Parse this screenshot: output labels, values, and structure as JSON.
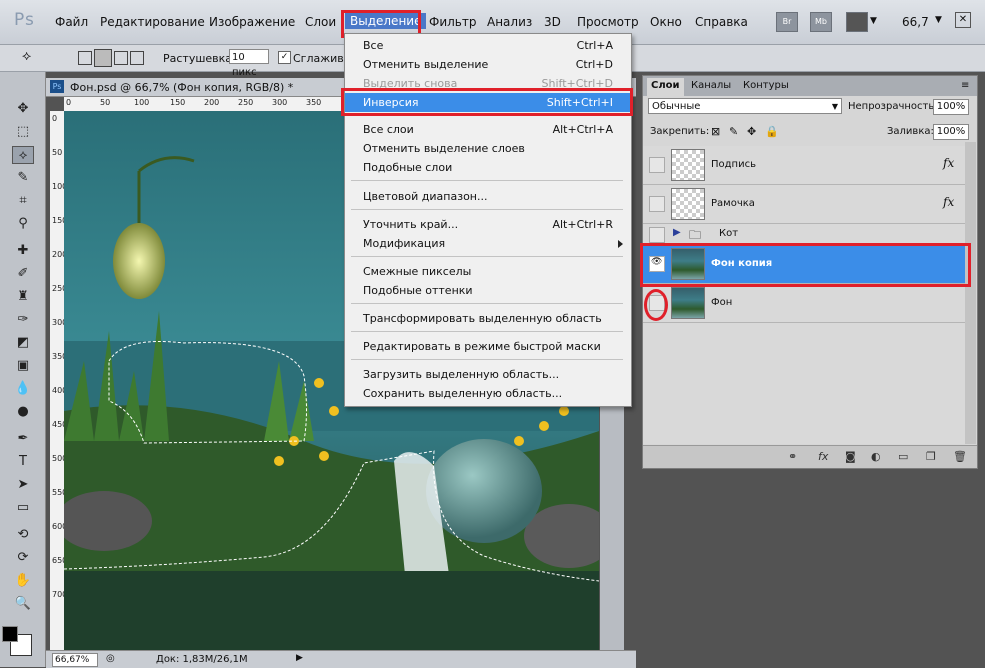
{
  "app": {
    "logo": "Ps"
  },
  "menubar": {
    "items": [
      "Файл",
      "Редактирование",
      "Изображение",
      "Слои",
      "Выделение",
      "Фильтр",
      "Анализ",
      "3D",
      "Просмотр",
      "Окно",
      "Справка"
    ],
    "buttons": [
      "Br",
      "Mb"
    ],
    "zoom": "66,7"
  },
  "options": {
    "feather_label": "Растушевка:",
    "feather_value": "10 пикс",
    "antialias_label": "Сглаживан"
  },
  "document": {
    "title": "Фон.psd @ 66,7% (Фон копия, RGB/8) *",
    "ruler_top": [
      "0",
      "50",
      "100",
      "150",
      "200",
      "250",
      "300",
      "350"
    ],
    "ruler_left": [
      "0",
      "50",
      "100",
      "150",
      "200",
      "250",
      "300",
      "350",
      "400",
      "450",
      "500",
      "550",
      "600",
      "650",
      "700"
    ],
    "status_zoom": "66,67%",
    "status_doc": "Док: 1,83M/26,1M"
  },
  "select_menu": {
    "items": [
      {
        "label": "Все",
        "shortcut": "Ctrl+A"
      },
      {
        "label": "Отменить выделение",
        "shortcut": "Ctrl+D"
      },
      {
        "label": "Выделить снова",
        "shortcut": "Shift+Ctrl+D"
      },
      {
        "label": "Инверсия",
        "shortcut": "Shift+Ctrl+I"
      },
      {
        "label": "Все слои",
        "shortcut": "Alt+Ctrl+A"
      },
      {
        "label": "Отменить выделение слоев",
        "shortcut": ""
      },
      {
        "label": "Подобные слои",
        "shortcut": ""
      },
      {
        "label": "Цветовой диапазон...",
        "shortcut": ""
      },
      {
        "label": "Уточнить край...",
        "shortcut": "Alt+Ctrl+R"
      },
      {
        "label": "Модификация",
        "shortcut": ""
      },
      {
        "label": "Смежные пикселы",
        "shortcut": ""
      },
      {
        "label": "Подобные оттенки",
        "shortcut": ""
      },
      {
        "label": "Трансформировать выделенную область",
        "shortcut": ""
      },
      {
        "label": "Редактировать в режиме быстрой маски",
        "shortcut": ""
      },
      {
        "label": "Загрузить выделенную область...",
        "shortcut": ""
      },
      {
        "label": "Сохранить выделенную область...",
        "shortcut": ""
      }
    ]
  },
  "layers_panel": {
    "tabs": [
      "Слои",
      "Каналы",
      "Контуры"
    ],
    "blend_mode": "Обычные",
    "opacity_label": "Непрозрачность:",
    "opacity_value": "100%",
    "lock_label": "Закрепить:",
    "fill_label": "Заливка:",
    "fill_value": "100%",
    "layers": [
      {
        "name": "Подпись",
        "fx": "fx"
      },
      {
        "name": "Рамочка",
        "fx": "fx"
      },
      {
        "name": "Кот"
      },
      {
        "name": "Фон копия"
      },
      {
        "name": "Фон"
      }
    ]
  },
  "colors": {
    "accent": "#3b8de8",
    "highlight_red": "#e0202a",
    "panel": "#d6d6d6"
  }
}
